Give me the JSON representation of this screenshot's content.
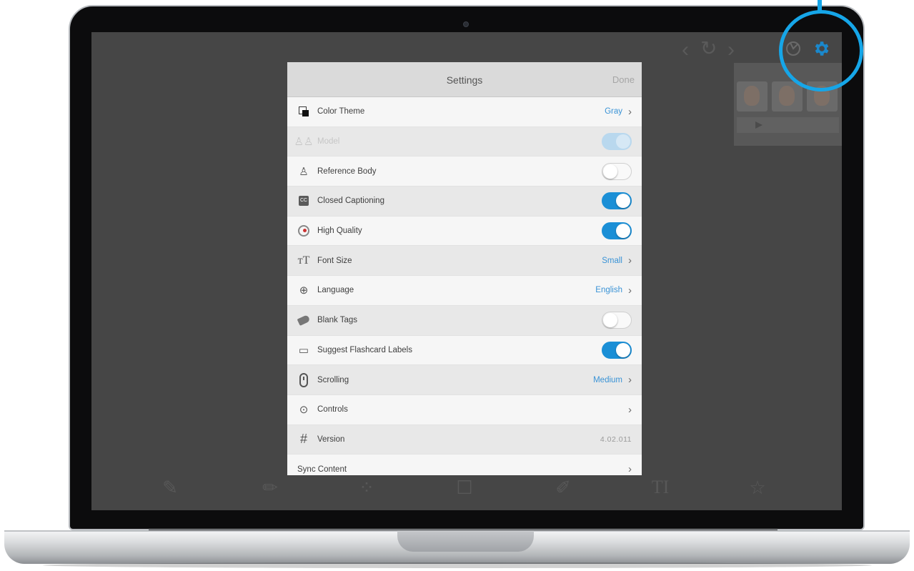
{
  "modal": {
    "title": "Settings",
    "done_label": "Done",
    "rows": [
      {
        "label": "Color Theme",
        "value": "Gray",
        "icon": "color-theme-icon"
      },
      {
        "label": "Model",
        "toggle": "disabled",
        "icon": "model-icon"
      },
      {
        "label": "Reference Body",
        "toggle": "off",
        "icon": "reference-body-icon"
      },
      {
        "label": "Closed Captioning",
        "toggle": "on",
        "icon": "closed-captioning-icon"
      },
      {
        "label": "High Quality",
        "toggle": "on",
        "icon": "high-quality-icon"
      },
      {
        "label": "Font Size",
        "value": "Small",
        "icon": "font-size-icon"
      },
      {
        "label": "Language",
        "value": "English",
        "icon": "language-icon"
      },
      {
        "label": "Blank Tags",
        "toggle": "off",
        "icon": "tag-icon"
      },
      {
        "label": "Suggest Flashcard Labels",
        "toggle": "on",
        "icon": "flashcard-icon"
      },
      {
        "label": "Scrolling",
        "value": "Medium",
        "icon": "mouse-scroll-icon"
      },
      {
        "label": "Controls",
        "icon": "controls-icon"
      },
      {
        "label": "Version",
        "version": "4.02.011",
        "icon": "hash-icon"
      },
      {
        "label": "Sync Content"
      }
    ]
  },
  "toolbar": {
    "items": [
      {
        "glyph": "✎",
        "label": ""
      },
      {
        "glyph": "✏",
        "label": ""
      },
      {
        "glyph": "⁘",
        "label": ""
      },
      {
        "glyph": "☐",
        "label": ""
      },
      {
        "glyph": "✐",
        "label": ""
      },
      {
        "glyph": "TI",
        "label": ""
      },
      {
        "glyph": "☆",
        "label": ""
      }
    ]
  },
  "colors": {
    "accent": "#1b8fd6",
    "highlight": "#16a6e8",
    "background_app": "#464646"
  }
}
